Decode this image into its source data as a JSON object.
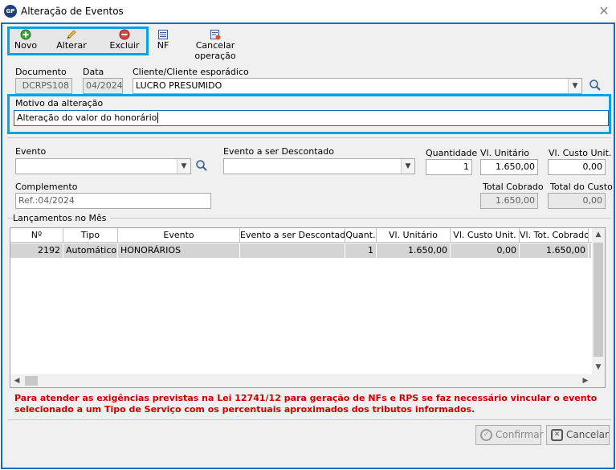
{
  "window": {
    "title": "Alteração de Eventos",
    "app_badge": "GP"
  },
  "toolbar": {
    "novo": "Novo",
    "alterar": "Alterar",
    "excluir": "Excluir",
    "nf": "NF",
    "cancelar_operacao": "Cancelar operação"
  },
  "header_fields": {
    "documento_label": "Documento",
    "documento_value": "DCRPS108",
    "data_label": "Data",
    "data_value": "04/2024",
    "cliente_label": "Cliente/Cliente esporádico",
    "cliente_value": "LUCRO PRESUMIDO"
  },
  "motivo": {
    "label": "Motivo da alteração",
    "value": "Alteração do valor do honorário"
  },
  "evento_form": {
    "evento_label": "Evento",
    "evento_value": "",
    "evento_descontado_label": "Evento a ser Descontado",
    "evento_descontado_value": "",
    "quantidade_label": "Quantidade",
    "quantidade_value": "1",
    "vl_unitario_label": "Vl. Unitário",
    "vl_unitario_value": "1.650,00",
    "vl_custo_unit_label": "Vl. Custo Unit.",
    "vl_custo_unit_value": "0,00",
    "complemento_label": "Complemento",
    "complemento_value": "Ref.:04/2024",
    "total_cobrado_label": "Total Cobrado",
    "total_cobrado_value": "1.650,00",
    "total_custo_label": "Total do Custo",
    "total_custo_value": "0,00"
  },
  "lancamentos": {
    "title": "Lançamentos no Mês",
    "columns": [
      "Nº",
      "Tipo",
      "Evento",
      "Evento a ser Descontado",
      "Quant.",
      "Vl. Unitário",
      "Vl. Custo Unit.",
      "Vl. Tot. Cobrado"
    ],
    "rows": [
      [
        "2192",
        "Automático",
        "HONORÁRIOS",
        "",
        "1",
        "1.650,00",
        "0,00",
        "1.650,00"
      ]
    ]
  },
  "warning": {
    "line1": "Para atender as exigências previstas na Lei 12741/12 para geração de NFs e RPS se faz necessário vincular o evento",
    "line2": "selecionado a um Tipo de Serviço com os percentuais aproximados dos tributos informados."
  },
  "footer": {
    "confirmar": "Confirmar",
    "cancelar": "Cancelar"
  },
  "colors": {
    "accent_highlight": "#08a2e0",
    "frame_border": "#0a6dc2",
    "warning_text": "#d00000"
  }
}
